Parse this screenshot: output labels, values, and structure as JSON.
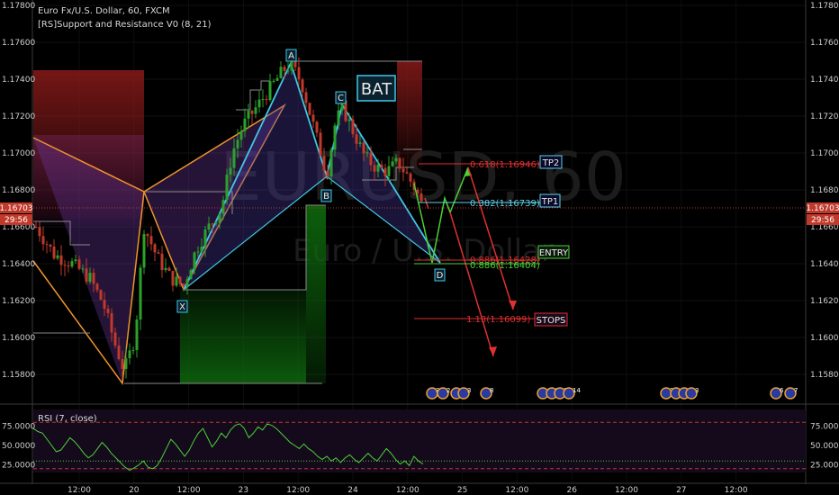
{
  "header": {
    "symbol_line": "Euro Fx/U.S. Dollar, 60, FXCM",
    "indicator_line": "[RS]Support and Resistance V0 (8, 21)"
  },
  "watermark": {
    "symbol": "EURUSD, 60",
    "name": "Euro / U.S. Dollar"
  },
  "pattern": {
    "name": "BAT",
    "points": {
      "X": "X",
      "A": "A",
      "B": "B",
      "C": "C",
      "D": "D"
    }
  },
  "fib_levels": {
    "tp2": "0.618(1.16946)",
    "tp1": "0.382(1.16739)",
    "entry_a": "0.886(1.16428)",
    "entry_b": "0.886(1.16404)",
    "stops": "1.13(1.16099)"
  },
  "tags": {
    "tp2": "TP2",
    "tp1": "TP1",
    "entry": "ENTRY",
    "stops": "STOPS"
  },
  "price_axis": {
    "ticks": [
      "1.17800",
      "1.17600",
      "1.17400",
      "1.17200",
      "1.17000",
      "1.16800",
      "1.16600",
      "1.16400",
      "1.16200",
      "1.16000",
      "1.15800"
    ],
    "current_price": "1.16703",
    "countdown": "29:56"
  },
  "time_axis": {
    "labels": [
      "12:00",
      "20",
      "12:00",
      "23",
      "12:00",
      "24",
      "12:00",
      "25",
      "12:00",
      "26",
      "12:00",
      "27",
      "12:00"
    ]
  },
  "events": [
    {
      "count": "3"
    },
    {
      "count": "2"
    },
    {
      "count": "3"
    },
    {
      "count": "3"
    },
    {
      "count": "8"
    },
    {
      "count": "4"
    },
    {
      "count": "5"
    },
    {
      "count": "3"
    },
    {
      "count": "14"
    },
    {
      "count": "2"
    },
    {
      "count": "4"
    },
    {
      "count": "3"
    },
    {
      "count": "3"
    },
    {
      "count": "6"
    },
    {
      "count": "7"
    }
  ],
  "rsi": {
    "title": "RSI (7, close)",
    "ticks": [
      "75.0000",
      "50.0000",
      "25.0000"
    ],
    "left_ticks": [
      "75.0000",
      "50.0000",
      "25.0000"
    ],
    "upper_band": 80,
    "lower_band": 20,
    "values": [
      72,
      68,
      66,
      58,
      50,
      42,
      44,
      52,
      60,
      55,
      48,
      40,
      34,
      38,
      46,
      54,
      48,
      40,
      34,
      28,
      22,
      18,
      21,
      25,
      30,
      22,
      20,
      24,
      34,
      46,
      58,
      52,
      44,
      36,
      44,
      56,
      66,
      72,
      60,
      48,
      56,
      66,
      60,
      70,
      76,
      78,
      72,
      60,
      66,
      74,
      70,
      78,
      76,
      72,
      66,
      60,
      54,
      50,
      46,
      52,
      46,
      42,
      36,
      32,
      36,
      30,
      34,
      28,
      34,
      38,
      32,
      28,
      34,
      40,
      34,
      30,
      38,
      46,
      40,
      32,
      26,
      30,
      24,
      36,
      30,
      26
    ]
  },
  "colors": {
    "bull": "#2ca02c",
    "bear": "#c0392b",
    "xabcd": "#3fc7e6",
    "wedge": "#f0932b",
    "fib_red": "#e03030",
    "fib_green": "#4cd137",
    "fib_cyan": "#5fd1e8",
    "rsi_line": "#4cd137"
  }
}
